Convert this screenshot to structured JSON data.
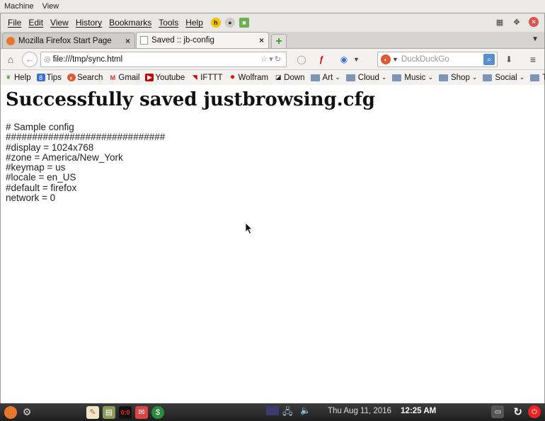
{
  "vm_menu": [
    "Machine",
    "View"
  ],
  "menubar": {
    "items": [
      {
        "label": "File"
      },
      {
        "label": "Edit"
      },
      {
        "label": "View"
      },
      {
        "label": "History"
      },
      {
        "label": "Bookmarks"
      },
      {
        "label": "Tools"
      },
      {
        "label": "Help"
      }
    ]
  },
  "tabs": [
    {
      "title": "Mozilla Firefox Start Page",
      "close": "×"
    },
    {
      "title": "Saved :: jb-config",
      "close": "×"
    }
  ],
  "newtab": "+",
  "navbar": {
    "url": "file:///tmp/sync.html",
    "search_placeholder": "DuckDuckGo"
  },
  "bookmarks": [
    {
      "label": "Help",
      "icon": "help-icon",
      "color": "#5a9a3a"
    },
    {
      "label": "Tips",
      "icon": "tips-icon",
      "color": "#3b6fd0"
    },
    {
      "label": "Search",
      "icon": "duckduckgo-icon",
      "color": "#de5833"
    },
    {
      "label": "Gmail",
      "icon": "gmail-icon",
      "color": "#d93025"
    },
    {
      "label": "Youtube",
      "icon": "youtube-icon",
      "color": "#cc0000"
    },
    {
      "label": "IFTTT",
      "icon": "ifttt-icon",
      "color": "#222222"
    },
    {
      "label": "Wolfram",
      "icon": "wolfram-icon",
      "color": "#dd1100"
    },
    {
      "label": "Down",
      "icon": "down-icon",
      "color": "#222222"
    },
    {
      "label": "Art",
      "icon": "folder-icon",
      "folder": true
    },
    {
      "label": "Cloud",
      "icon": "folder-icon",
      "folder": true
    },
    {
      "label": "Music",
      "icon": "folder-icon",
      "folder": true
    },
    {
      "label": "Shop",
      "icon": "folder-icon",
      "folder": true
    },
    {
      "label": "Social",
      "icon": "folder-icon",
      "folder": true
    },
    {
      "label": "TV",
      "icon": "folder-icon",
      "folder": true
    }
  ],
  "page": {
    "heading": "Successfully saved justbrowsing.cfg",
    "config_lines": [
      "# Sample config",
      "##############################",
      "#display = 1024x768",
      "#zone = America/New_York",
      "#keymap = us",
      "#locale = en_US",
      "#default = firefox",
      "network = 0"
    ]
  },
  "taskbar": {
    "date": "Thu Aug 11, 2016",
    "time": "12:25 AM"
  }
}
